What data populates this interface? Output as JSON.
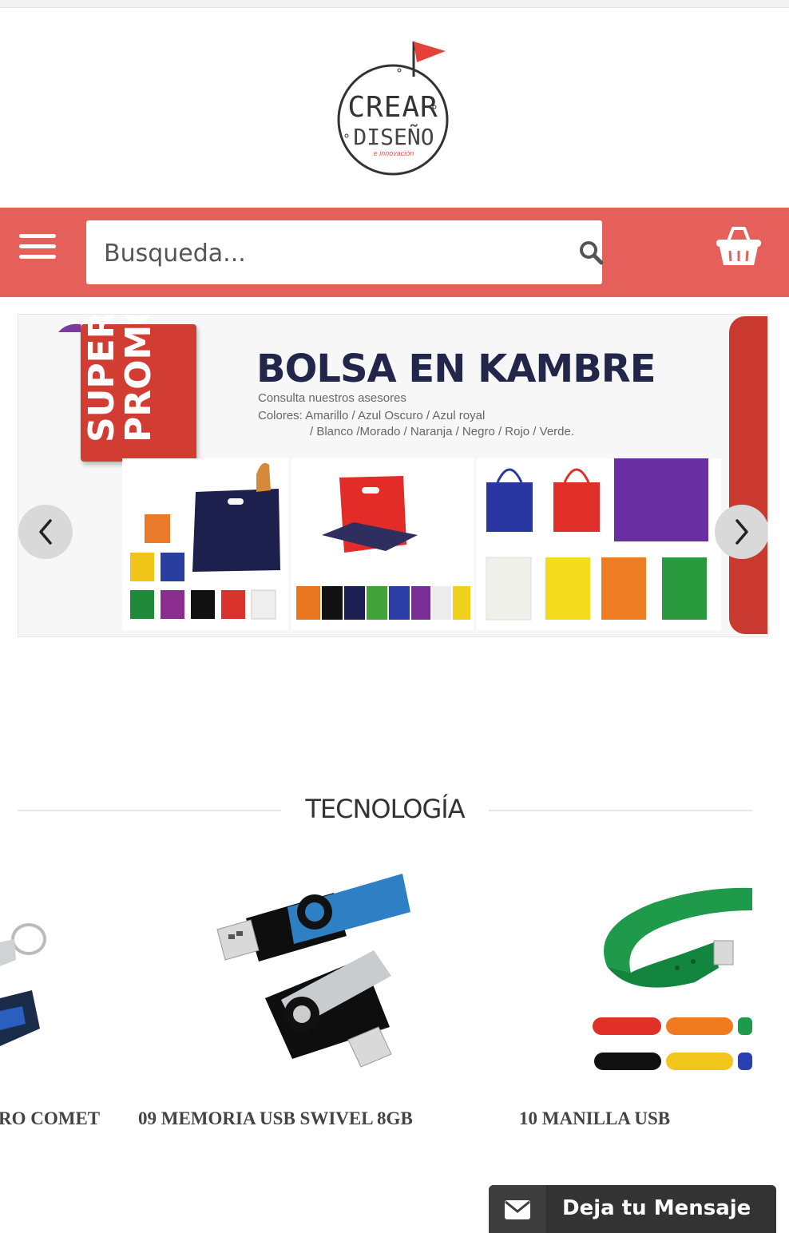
{
  "brand": {
    "logo_line1": "CREAR",
    "logo_line2": "DISEÑO",
    "logo_line3": "e innovación",
    "accent_color": "#e5605b"
  },
  "header": {
    "menu_icon": "hamburger-menu-icon",
    "search_placeholder": "Busqueda...",
    "search_icon": "search-icon",
    "cart_icon": "shopping-basket-icon"
  },
  "banner": {
    "promo_label_line1": "SUPER",
    "promo_label_line2": "PROMO",
    "title": "BOLSA EN KAMBRE",
    "subtitle": "Consulta nuestros asesores",
    "colors_line1": "Colores: Amarillo / Azul Oscuro / Azul royal",
    "colors_line2": "/ Blanco /Morado / Naranja / Negro / Rojo / Verde.",
    "prev_icon": "chevron-left-icon",
    "next_icon": "chevron-right-icon"
  },
  "section": {
    "title": "TECNOLOGÍA"
  },
  "products": [
    {
      "name": "RO COMET",
      "image": "usb-keychain"
    },
    {
      "name": "09 MEMORIA USB SWIVEL 8GB",
      "image": "usb-swivel"
    },
    {
      "name": "10 MANILLA USB",
      "image": "usb-bracelet"
    }
  ],
  "message_button": {
    "label": "Deja tu Mensaje",
    "icon": "envelope-icon"
  }
}
